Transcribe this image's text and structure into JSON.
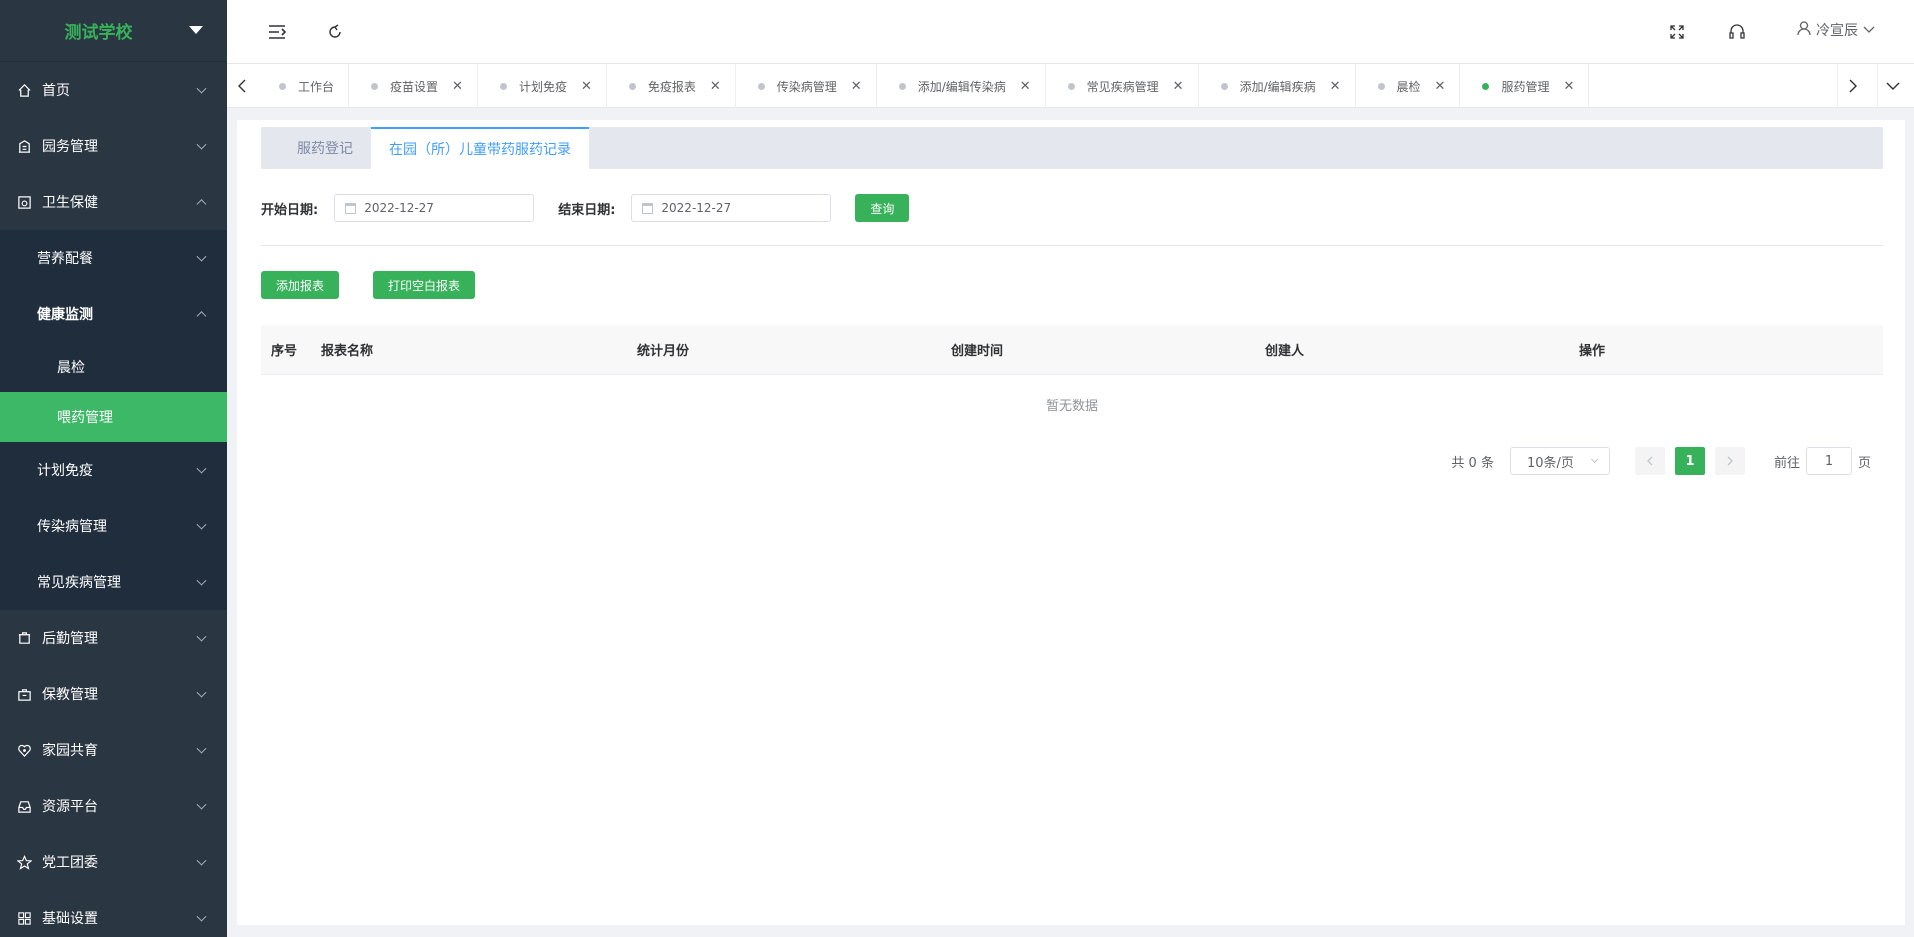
{
  "app": {
    "school_name": "测试学校"
  },
  "sidebar": {
    "items": [
      {
        "label": "首页",
        "icon": "home-icon"
      },
      {
        "label": "园务管理",
        "icon": "building-icon"
      },
      {
        "label": "卫生保健",
        "icon": "health-icon"
      },
      {
        "label": "后勤管理",
        "icon": "logistics-icon"
      },
      {
        "label": "保教管理",
        "icon": "briefcase-icon"
      },
      {
        "label": "家园共育",
        "icon": "heart-icon"
      },
      {
        "label": "资源平台",
        "icon": "inbox-icon"
      },
      {
        "label": "党工团委",
        "icon": "star-icon"
      },
      {
        "label": "基础设置",
        "icon": "grid-icon"
      }
    ],
    "health_sub": [
      {
        "label": "营养配餐"
      },
      {
        "label": "健康监测"
      },
      {
        "label": "计划免疫"
      },
      {
        "label": "传染病管理"
      },
      {
        "label": "常见疾病管理"
      }
    ],
    "monitor_sub": [
      {
        "label": "晨检"
      },
      {
        "label": "喂药管理"
      }
    ]
  },
  "header": {
    "user_name": "冷宣辰"
  },
  "tabs": [
    {
      "label": "工作台"
    },
    {
      "label": "疫苗设置"
    },
    {
      "label": "计划免疫"
    },
    {
      "label": "免疫报表"
    },
    {
      "label": "传染病管理"
    },
    {
      "label": "添加/编辑传染病"
    },
    {
      "label": "常见疾病管理"
    },
    {
      "label": "添加/编辑疾病"
    },
    {
      "label": "晨检"
    },
    {
      "label": "服药管理"
    }
  ],
  "subtabs": {
    "first": "服药登记",
    "second": "在园（所）儿童带药服药记录"
  },
  "filter": {
    "start_label": "开始日期:",
    "start_value": "2022-12-27",
    "end_label": "结束日期:",
    "end_value": "2022-12-27",
    "query_label": "查询"
  },
  "actions": {
    "add": "添加报表",
    "print": "打印空白报表"
  },
  "table": {
    "columns": [
      "序号",
      "报表名称",
      "统计月份",
      "创建时间",
      "创建人",
      "操作"
    ],
    "empty_text": "暂无数据"
  },
  "pagination": {
    "total": "共 0 条",
    "page_size": "10条/页",
    "current_page": "1",
    "goto_prefix": "前往",
    "goto_value": "1",
    "goto_suffix": "页"
  }
}
